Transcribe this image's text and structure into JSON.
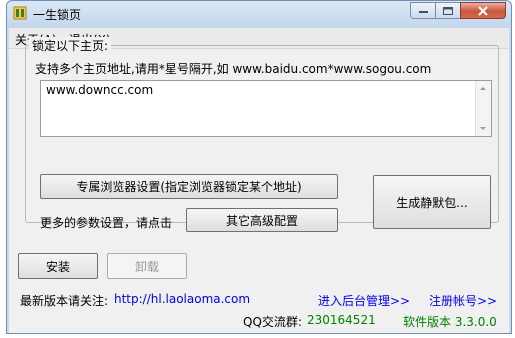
{
  "window": {
    "title": "一生锁页",
    "controls": {
      "minimize_icon": "minimize-icon",
      "maximize_icon": "maximize-icon",
      "close_icon": "close-icon"
    }
  },
  "menubar": {
    "items": [
      {
        "label": "关于(A)"
      },
      {
        "label": "退出(X)"
      }
    ]
  },
  "lock_group": {
    "legend": "锁定以下主页:",
    "hint": "支持多个主页地址,请用*星号隔开,如  www.baidu.com*www.sogou.com",
    "urls_value": "www.downcc.com",
    "browser_settings_button": "专属浏览器设置(指定浏览器锁定某个地址)",
    "more_params_label": "更多的参数设置，请点击",
    "advanced_button": "其它高级配置",
    "generate_button": "生成静默包..."
  },
  "actions": {
    "install_button": "安装",
    "uninstall_button": "卸载"
  },
  "footer": {
    "follow_label": "最新版本请关注:",
    "follow_link": "http://hl.laolaoma.com",
    "admin_link": "进入后台管理>>",
    "register_link": "注册帐号>>",
    "qq_label": "QQ交流群:",
    "qq_value": "230164521",
    "version_label": "软件版本 3.3.0.0"
  },
  "colors": {
    "link": "#0000ee",
    "green": "#008000",
    "window_frame": "#c9dbef",
    "client_bg": "#f0f0f0"
  }
}
